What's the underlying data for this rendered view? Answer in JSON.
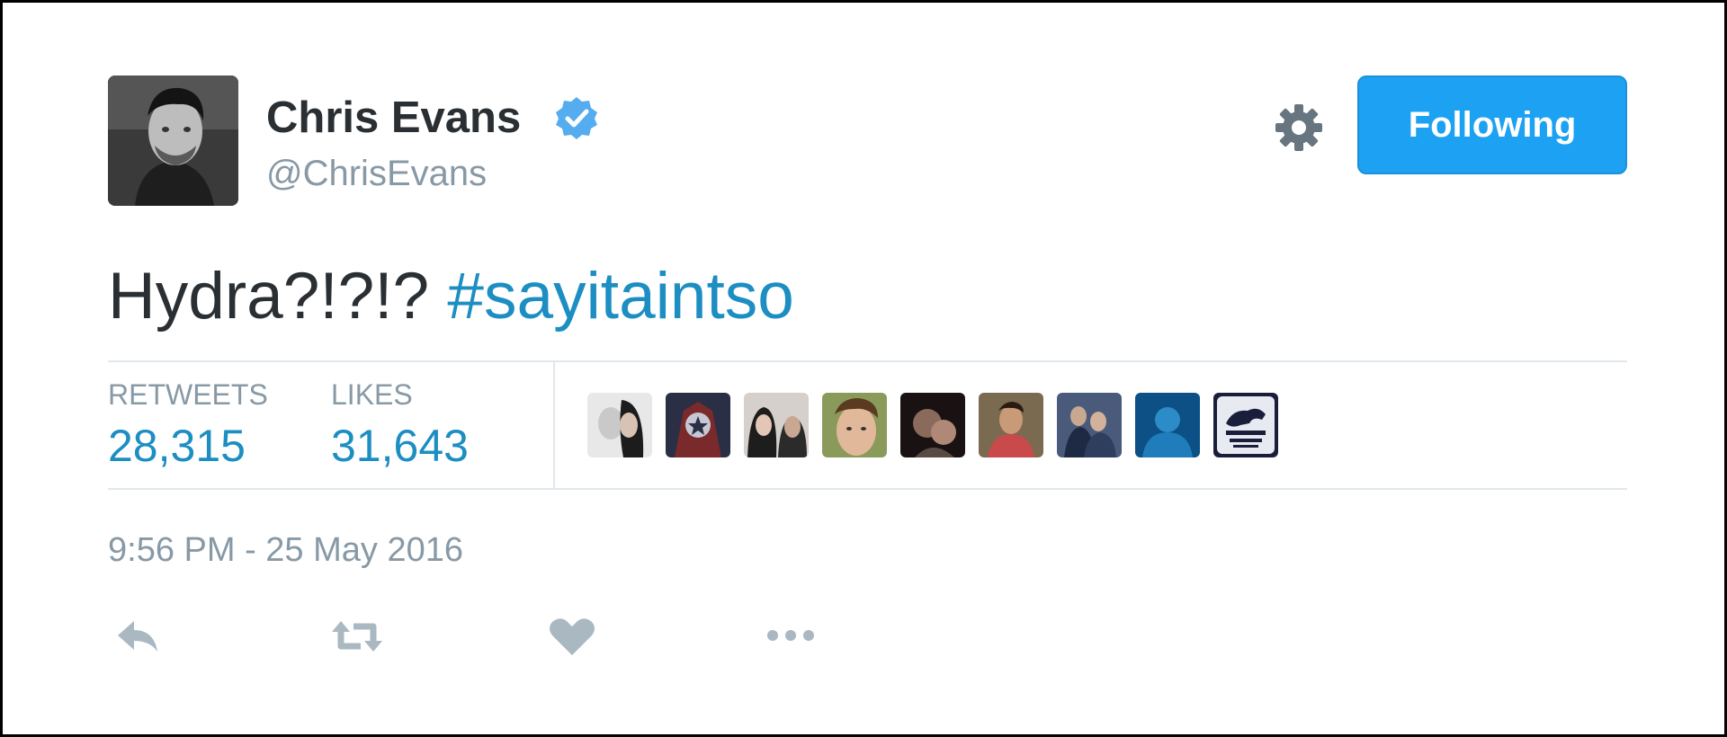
{
  "author": {
    "name": "Chris Evans",
    "handle": "@ChrisEvans",
    "verified": true,
    "avatar_icon": "profile-photo"
  },
  "header": {
    "follow_label": "Following",
    "settings_icon": "gear-icon"
  },
  "tweet": {
    "text": "Hydra?!?!?",
    "hashtag": "#sayitaintso"
  },
  "stats": {
    "retweets_label": "RETWEETS",
    "retweets_count": "28,315",
    "likes_label": "LIKES",
    "likes_count": "31,643"
  },
  "likers": [
    {
      "icon": "liker-avatar-1"
    },
    {
      "icon": "liker-avatar-2"
    },
    {
      "icon": "liker-avatar-3"
    },
    {
      "icon": "liker-avatar-4"
    },
    {
      "icon": "liker-avatar-5"
    },
    {
      "icon": "liker-avatar-6"
    },
    {
      "icon": "liker-avatar-7"
    },
    {
      "icon": "liker-avatar-8"
    },
    {
      "icon": "liker-avatar-9"
    }
  ],
  "timestamp": "9:56 PM - 25 May 2016",
  "actions": [
    {
      "icon": "reply-icon"
    },
    {
      "icon": "retweet-icon"
    },
    {
      "icon": "heart-icon"
    },
    {
      "icon": "more-icon"
    }
  ],
  "colors": {
    "accent": "#1da1f2",
    "link": "#1c8ec2",
    "text": "#292f33",
    "muted": "#8899a6",
    "divider": "#e1e8ed"
  }
}
